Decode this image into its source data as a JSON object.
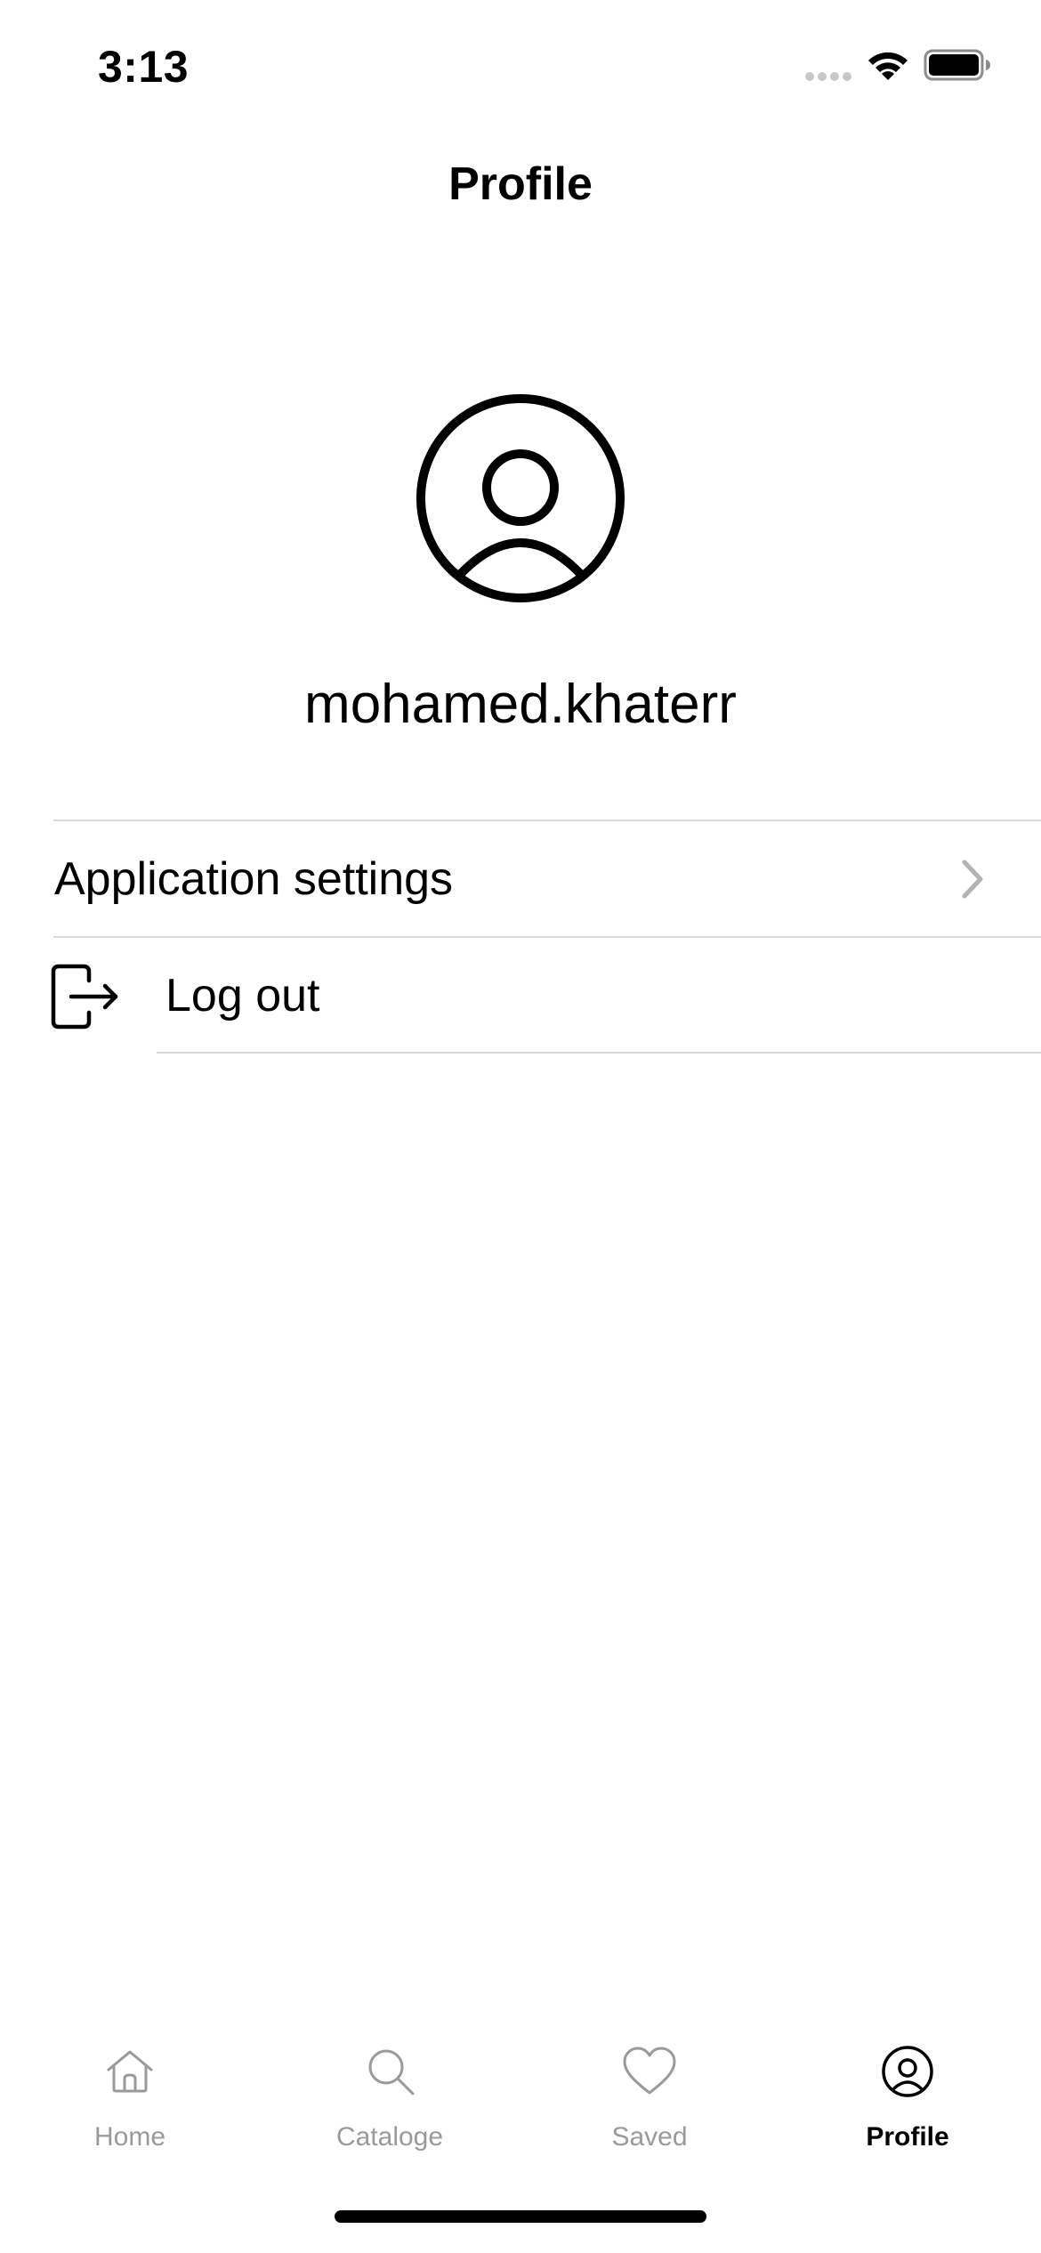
{
  "status_bar": {
    "time": "3:13",
    "icons": [
      "cellular-signal-icon",
      "wifi-icon",
      "battery-icon"
    ]
  },
  "nav": {
    "title": "Profile"
  },
  "profile": {
    "avatar_icon": "person-circle-icon",
    "username": "mohamed.khaterr"
  },
  "settings_list": {
    "items": [
      {
        "label": "Application settings",
        "icon": "chevron-right-icon"
      },
      {
        "label": "Log out",
        "icon": "logout-icon"
      }
    ]
  },
  "tab_bar": {
    "active": "Profile",
    "tabs": [
      {
        "label": "Home",
        "icon": "home-icon"
      },
      {
        "label": "Cataloge",
        "icon": "search-icon"
      },
      {
        "label": "Saved",
        "icon": "heart-icon"
      },
      {
        "label": "Profile",
        "icon": "person-circle-icon"
      }
    ]
  },
  "colors": {
    "text": "#000000",
    "inactive_tab": "#9a9a9a",
    "divider": "#d9d9d9",
    "background": "#ffffff"
  }
}
